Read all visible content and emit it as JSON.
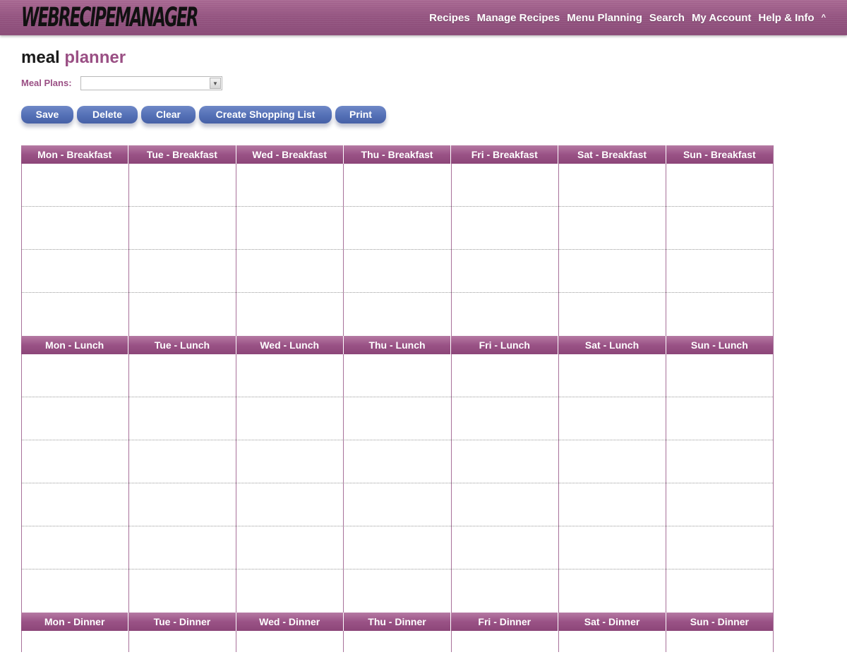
{
  "header": {
    "logo_text": "WEBRECIPEMANAGER",
    "nav": [
      "Recipes",
      "Manage Recipes",
      "Menu Planning",
      "Search",
      "My Account",
      "Help & Info"
    ],
    "nav_caret": "^"
  },
  "page": {
    "title_part1": "meal",
    "title_part2": "planner"
  },
  "meal_plans": {
    "label": "Meal Plans:",
    "selected_value": ""
  },
  "buttons": {
    "save": "Save",
    "delete": "Delete",
    "clear": "Clear",
    "create_shopping_list": "Create Shopping List",
    "print": "Print"
  },
  "grid": {
    "breakfast": [
      "Mon - Breakfast",
      "Tue - Breakfast",
      "Wed - Breakfast",
      "Thu - Breakfast",
      "Fri - Breakfast",
      "Sat - Breakfast",
      "Sun - Breakfast"
    ],
    "lunch": [
      "Mon - Lunch",
      "Tue - Lunch",
      "Wed - Lunch",
      "Thu - Lunch",
      "Fri - Lunch",
      "Sat - Lunch",
      "Sun - Lunch"
    ],
    "dinner": [
      "Mon - Dinner",
      "Tue - Dinner",
      "Wed - Dinner",
      "Thu - Dinner",
      "Fri - Dinner",
      "Sat - Dinner",
      "Sun - Dinner"
    ]
  },
  "colors": {
    "brand": "#955581",
    "accent_text": "#9a4f84",
    "button": "#5470b6"
  }
}
